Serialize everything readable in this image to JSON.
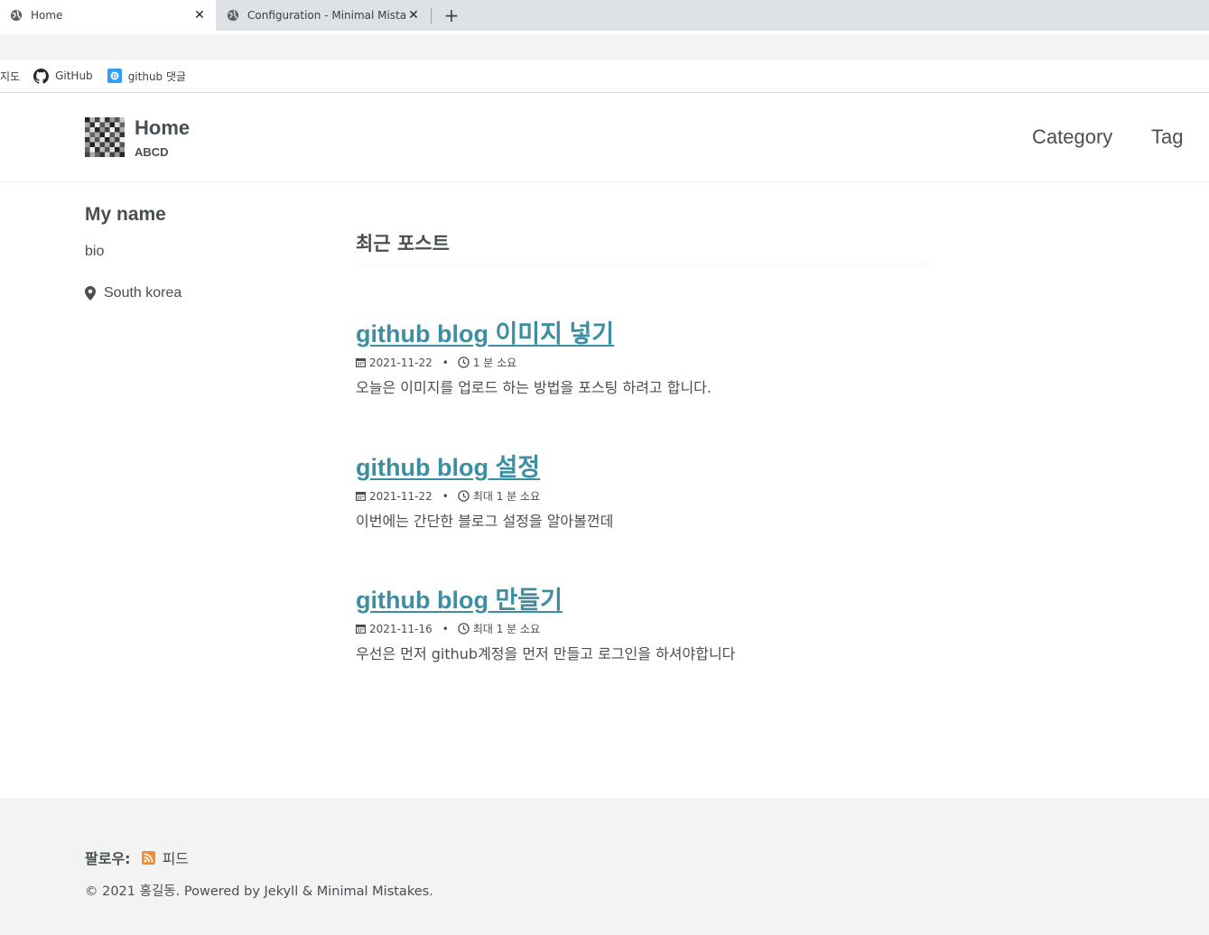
{
  "browser": {
    "tabs": [
      {
        "title": "Home",
        "active": true
      },
      {
        "title": "Configuration - Minimal Mistakes",
        "active": false
      }
    ],
    "new_tab_icon": "plus-icon",
    "bookmarks": [
      {
        "label": "지도",
        "icon": "none"
      },
      {
        "label": "GitHub",
        "icon": "github-icon"
      },
      {
        "label": "github 댓글",
        "icon": "disqus-icon"
      }
    ]
  },
  "masthead": {
    "title": "Home",
    "subtitle": "ABCD",
    "nav": [
      "Category",
      "Tag"
    ]
  },
  "sidebar": {
    "name": "My name",
    "bio": "bio",
    "location": "South korea"
  },
  "main": {
    "heading": "최근 포스트",
    "posts": [
      {
        "title": "github blog 이미지 넣기",
        "date": "2021-11-22",
        "read_time": "1 분 소요",
        "excerpt": "오늘은 이미지를 업로드 하는 방법을 포스팅 하려고 합니다."
      },
      {
        "title": "github blog 설정",
        "date": "2021-11-22",
        "read_time": "최대 1 분 소요",
        "excerpt": "이번에는 간단한 블로그 설정을 알아볼껀데"
      },
      {
        "title": "github blog 만들기",
        "date": "2021-11-16",
        "read_time": "최대 1 분 소요",
        "excerpt": "우선은 먼저 github계정을 먼저 만들고 로그인을 하셔야합니다"
      }
    ]
  },
  "footer": {
    "follow_label": "팔로우:",
    "feed_label": "피드",
    "copyright": "© 2021 홍길동. Powered by Jekyll & Minimal Mistakes."
  },
  "colors": {
    "link": "#3d8da3",
    "text": "#494e52",
    "footer_bg": "#f2f3f3",
    "rss": "#f28c33"
  }
}
